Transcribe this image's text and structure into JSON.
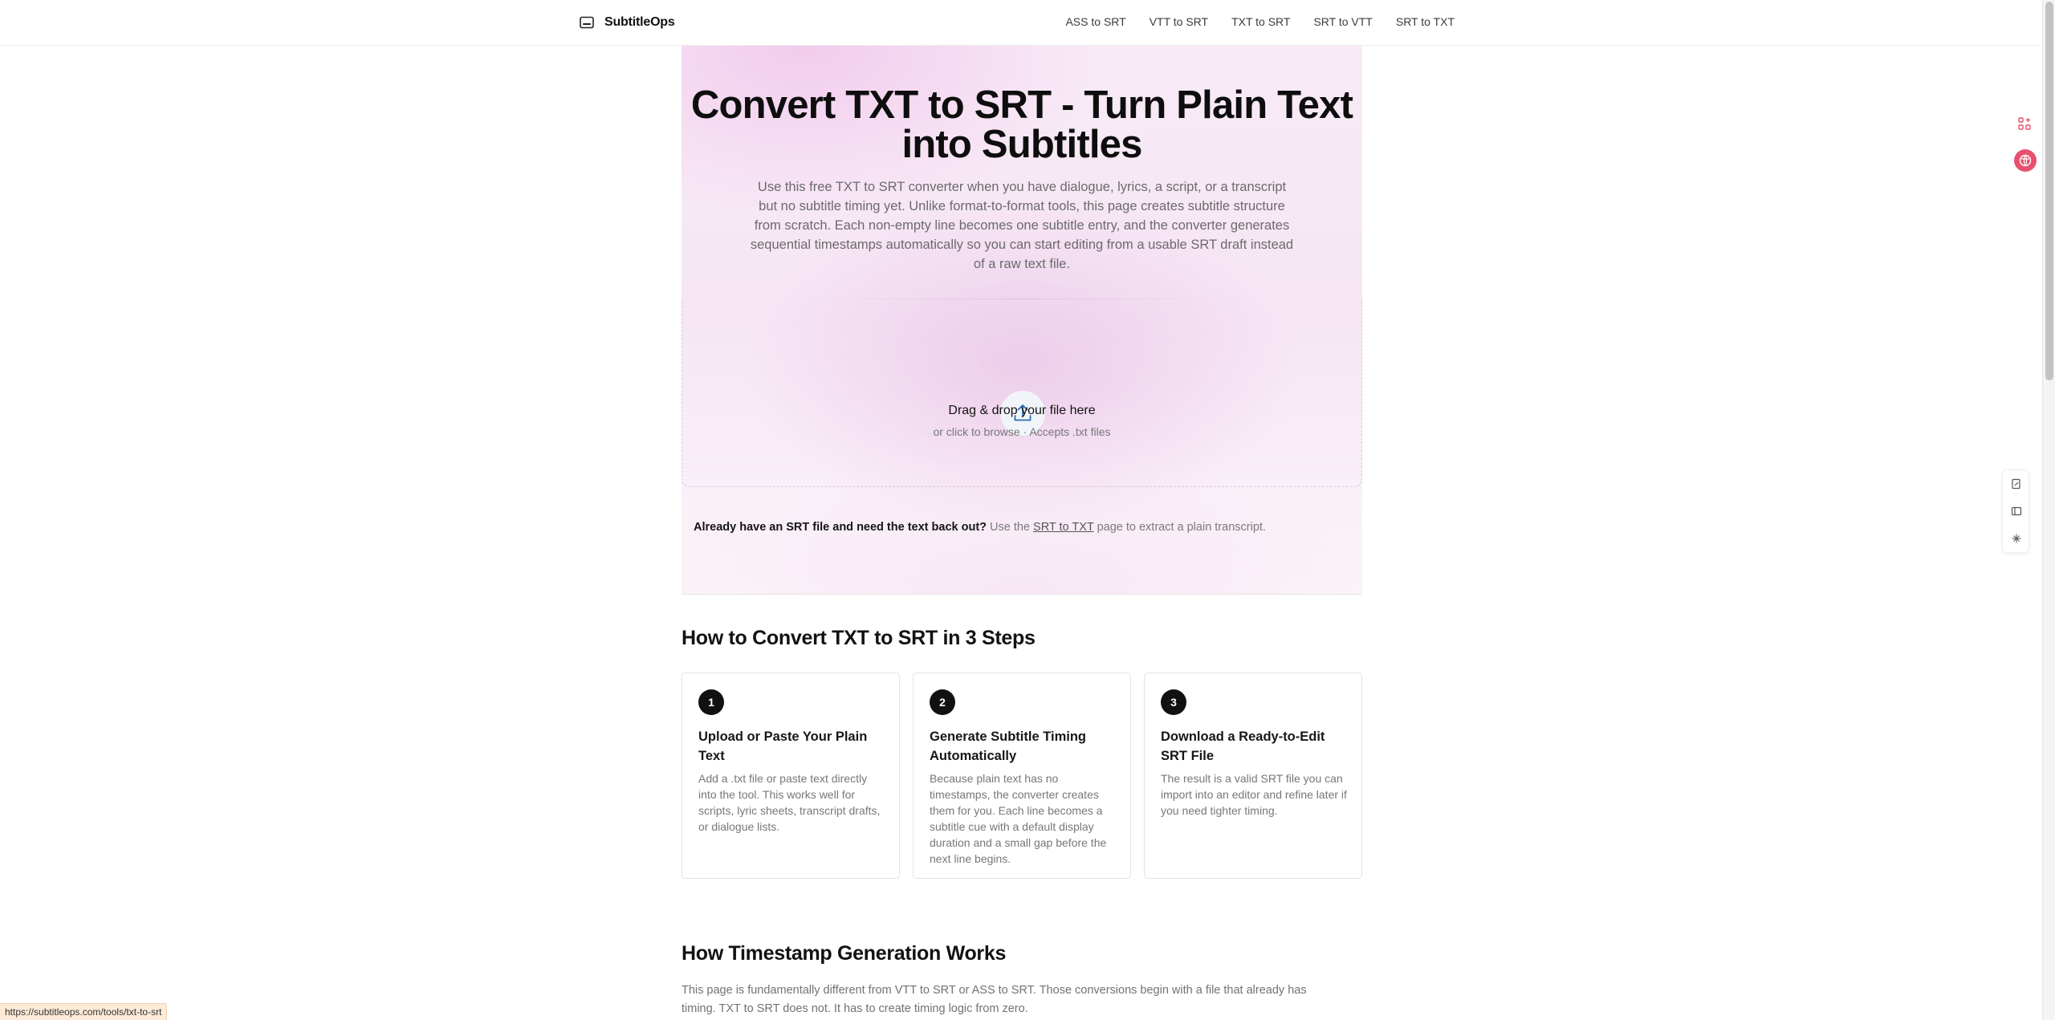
{
  "brand": {
    "name": "SubtitleOps"
  },
  "nav": [
    "ASS to SRT",
    "VTT to SRT",
    "TXT to SRT",
    "SRT to VTT",
    "SRT to TXT"
  ],
  "hero": {
    "title_line1": "Convert TXT to SRT - Turn Plain Text",
    "title_line2": "into Subtitles",
    "description": "Use this free TXT to SRT converter when you have dialogue, lyrics, a script, or a transcript but no subtitle timing yet. Unlike format-to-format tools, this page creates subtitle structure from scratch. Each non-empty line becomes one subtitle entry, and the converter generates sequential timestamps automatically so you can start editing from a usable SRT draft instead of a raw text file."
  },
  "dropzone": {
    "title": "Drag & drop your file here",
    "subtitle": "or click to browse · Accepts .txt files",
    "icon": "upload-icon"
  },
  "already": {
    "bold": "Already have an SRT file and need the text back out?",
    "pre": " Use the ",
    "link": "SRT to TXT",
    "post": " page to extract a plain transcript."
  },
  "steps": {
    "heading": "How to Convert TXT to SRT in 3 Steps",
    "items": [
      {
        "num": "1",
        "title": "Upload or Paste Your Plain Text",
        "body": "Add a .txt file or paste text directly into the tool. This works well for scripts, lyric sheets, transcript drafts, or dialogue lists."
      },
      {
        "num": "2",
        "title": "Generate Subtitle Timing Automatically",
        "body": "Because plain text has no timestamps, the converter creates them for you. Each line becomes a subtitle cue with a default display duration and a small gap before the next line begins."
      },
      {
        "num": "3",
        "title": "Download a Ready-to-Edit SRT File",
        "body": "The result is a valid SRT file you can import into an editor and refine later if you need tighter timing."
      }
    ]
  },
  "timestamp": {
    "heading": "How Timestamp Generation Works",
    "body": "This page is fundamentally different from VTT to SRT or ASS to SRT. Those conversions begin with a file that already has timing. TXT to SRT does not. It has to create timing logic from zero."
  },
  "status_url": "https://subtitleops.com/tools/txt-to-srt",
  "colors": {
    "accent_pink": "#e8506f",
    "upload_blue": "#2b6cb0"
  }
}
